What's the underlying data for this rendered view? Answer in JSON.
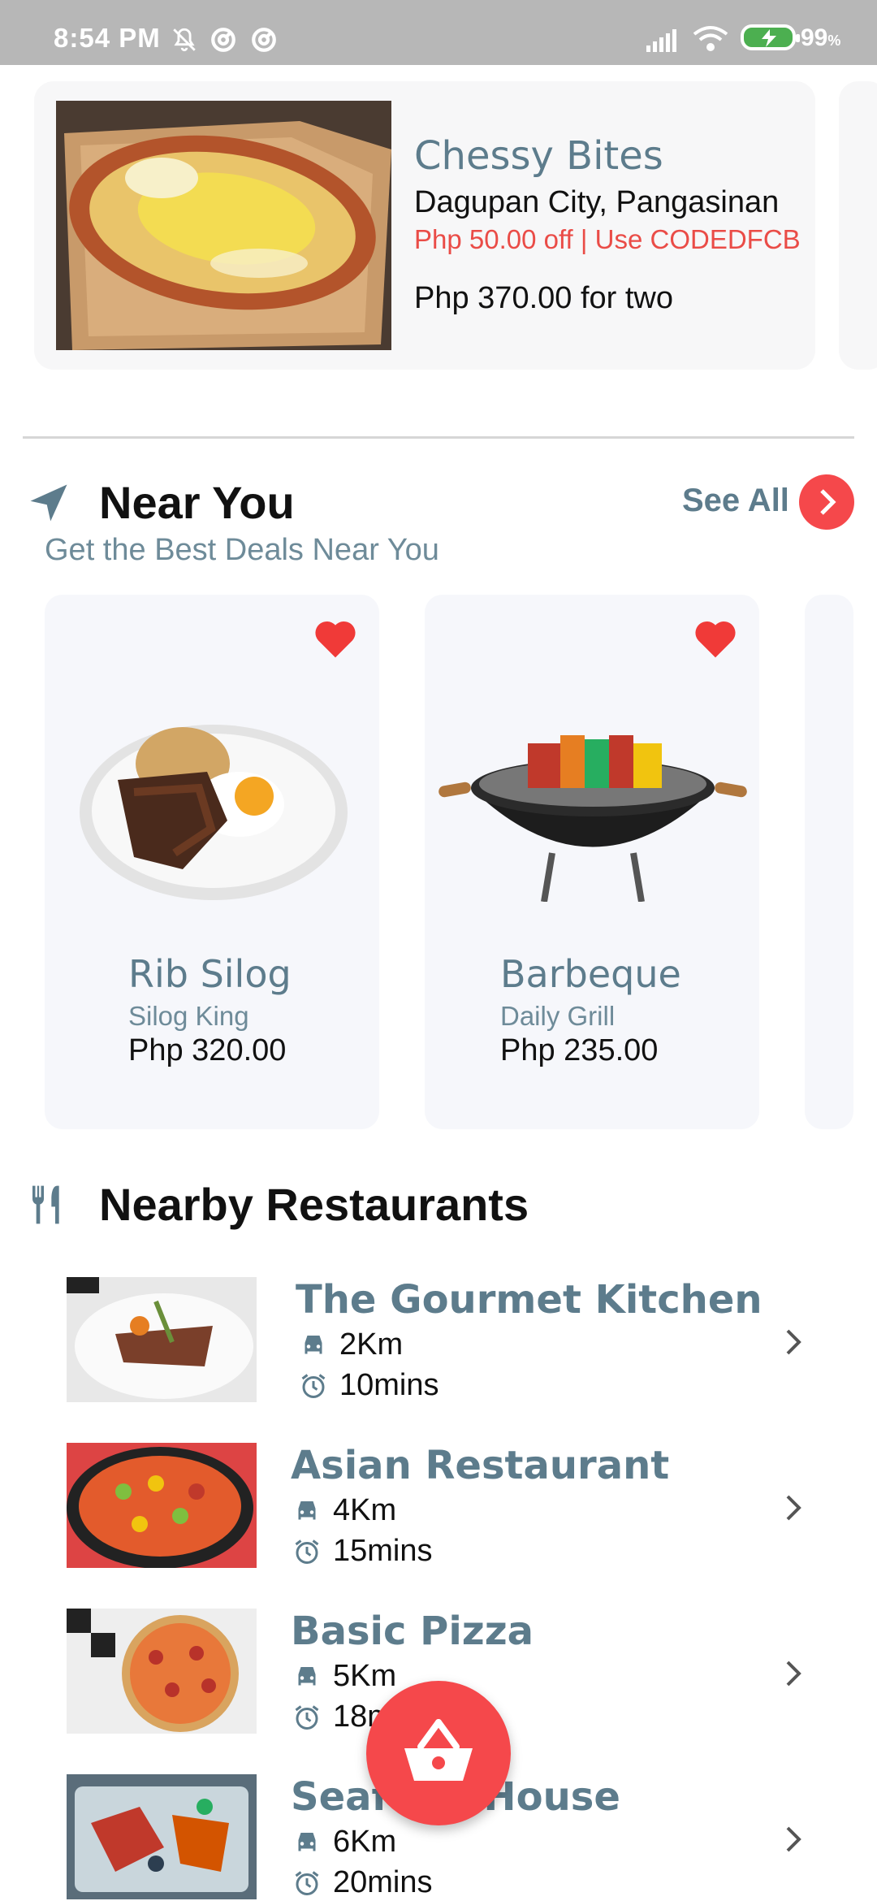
{
  "status_bar": {
    "time": "8:54 PM",
    "battery": "99",
    "battery_unit": "%"
  },
  "featured": {
    "title": "Chessy Bites",
    "location": "Dagupan City, Pangasinan",
    "promo": "Php 50.00 off | Use CODEDFCB",
    "price": "Php 370.00 for two"
  },
  "near_you": {
    "title": "Near You",
    "subtitle": "Get the Best Deals Near You",
    "see_all": "See All",
    "items": [
      {
        "name": "Rib Silog",
        "restaurant": "Silog King",
        "price": "Php 320.00",
        "favorited": true
      },
      {
        "name": "Barbeque",
        "restaurant": "Daily Grill",
        "price": "Php 235.00",
        "favorited": true
      }
    ]
  },
  "nearby": {
    "title": "Nearby Restaurants",
    "items": [
      {
        "name": "The Gourmet Kitchen",
        "distance": "2Km",
        "time": "10mins"
      },
      {
        "name": "Asian Restaurant",
        "distance": "4Km",
        "time": "15mins"
      },
      {
        "name": "Basic Pizza",
        "distance": "5Km",
        "time": "18mins"
      },
      {
        "name": "Seafood House",
        "distance": "6Km",
        "time": "20mins"
      }
    ]
  },
  "colors": {
    "accent": "#f5484b",
    "title_blue": "#5d7c8c",
    "promo_red": "#ea4c47",
    "status_bar": "#b7b7b7"
  }
}
